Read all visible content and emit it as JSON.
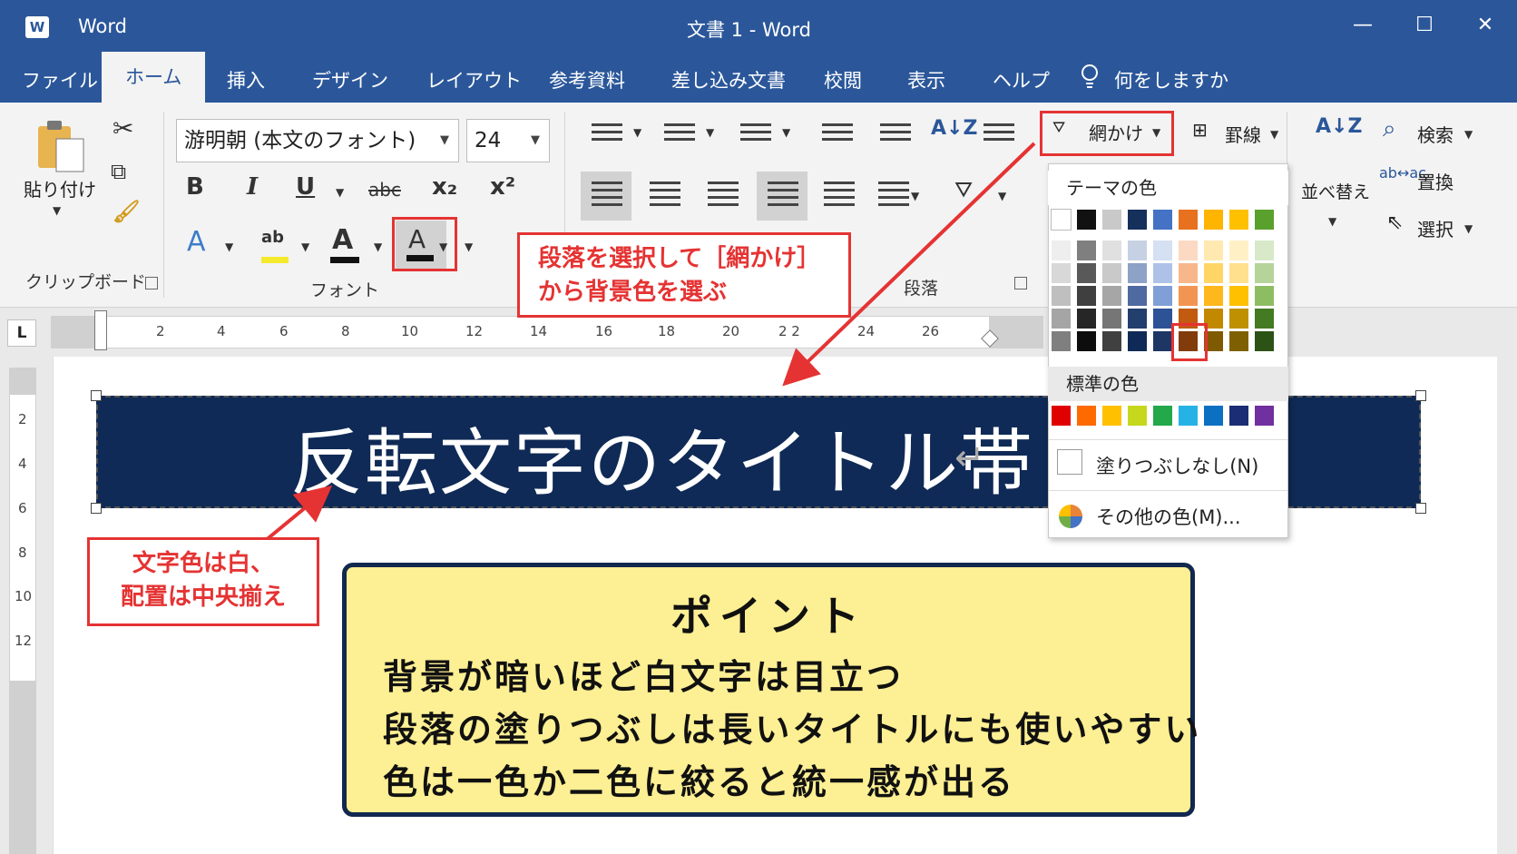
{
  "titlebar": {
    "app_icon": "W",
    "app_name": "Word",
    "doc_title": "文書 1  -  Word",
    "min": "—",
    "max": "☐",
    "close": "✕"
  },
  "tabs": [
    {
      "label": "ファイル"
    },
    {
      "label": "ホーム"
    },
    {
      "label": "挿入"
    },
    {
      "label": "デザイン"
    },
    {
      "label": "レイアウト"
    },
    {
      "label": "参考資料"
    },
    {
      "label": "差し込み文書"
    },
    {
      "label": "校閲"
    },
    {
      "label": "表示"
    },
    {
      "label": "ヘルプ"
    },
    {
      "label": "何をしますか"
    }
  ],
  "ribbon": {
    "clipboard": {
      "paste": "貼り付け",
      "group": "クリップボード"
    },
    "font": {
      "name": "游明朝 (本文のフォント)",
      "size": "24",
      "group": "フォント",
      "bold": "B",
      "italic": "I",
      "underline": "U",
      "strike": "abc",
      "sub": "x₂",
      "sup": "x²",
      "effect": "A",
      "highlight": "ab",
      "color": "A",
      "shading": "A"
    },
    "paragraph": {
      "group": "段落",
      "sort": "A↓Z"
    },
    "shading_btn": "網かけ",
    "border_btn": "罫線",
    "sort_btn": "並べ替え",
    "editing": {
      "find": "検索",
      "replace": "置換",
      "select": "選択"
    }
  },
  "ruler": {
    "corner": "L",
    "ticks": [
      "2",
      "4",
      "6",
      "8",
      "10",
      "12",
      "14",
      "16",
      "18",
      "20",
      "2 2",
      "24",
      "26"
    ],
    "vticks": [
      "2",
      "4",
      "6",
      "8",
      "10",
      "12"
    ]
  },
  "document": {
    "title_band": "反転文字のタイトル帯",
    "para_mark": "↵"
  },
  "callouts": {
    "shading": [
      "段落を選択して［網かけ］",
      "から背景色を選ぶ"
    ],
    "text_color": [
      "文字色は白、",
      "配置は中央揃え"
    ]
  },
  "point": {
    "title": "ポイント",
    "lines": [
      "背景が暗いほど白文字は目立つ",
      "段落の塗りつぶしは長いタイトルにも使いやすい",
      "色は一色か二色に絞ると統一感が出る"
    ]
  },
  "shading_menu": {
    "theme_label": "テーマの色",
    "standard_label": "標準の色",
    "no_fill": "塗りつぶしなし(N)",
    "more_colors": "その他の色(M)...",
    "theme_top": [
      "#ffffff",
      "#111111",
      "#c9c9c9",
      "#16305c",
      "#4472c4",
      "#e8711f",
      "#ffb400",
      "#ffc000",
      "#5aa02c"
    ],
    "theme_shades": [
      [
        "#eeeeee",
        "#7f7f7f",
        "#e0e0e0",
        "#c7d1e4",
        "#d5e0f2",
        "#fbd9c3",
        "#ffe9b0",
        "#fff0c6",
        "#d7e9c9"
      ],
      [
        "#d8d8d8",
        "#595959",
        "#c9c9c9",
        "#8ea2c8",
        "#adc2e6",
        "#f7b78b",
        "#ffd666",
        "#ffe08c",
        "#b4d49a"
      ],
      [
        "#bfbfbf",
        "#3f3f3f",
        "#a6a6a6",
        "#4f6aa0",
        "#7f9fd6",
        "#f39552",
        "#ffb81c",
        "#ffc000",
        "#8dbd63"
      ],
      [
        "#a5a5a5",
        "#262626",
        "#767676",
        "#223f6e",
        "#2d5296",
        "#c25a10",
        "#c28800",
        "#bf9000",
        "#437a22"
      ],
      [
        "#7f7f7f",
        "#0d0d0d",
        "#404040",
        "#0f2a56",
        "#1e3664",
        "#823c0b",
        "#805a00",
        "#7f6000",
        "#2c5216"
      ]
    ],
    "standard": [
      "#e00000",
      "#ff6a00",
      "#ffc000",
      "#c6d81e",
      "#23a84a",
      "#27b2e6",
      "#0b6fc2",
      "#1b2e75",
      "#7030a0"
    ]
  }
}
